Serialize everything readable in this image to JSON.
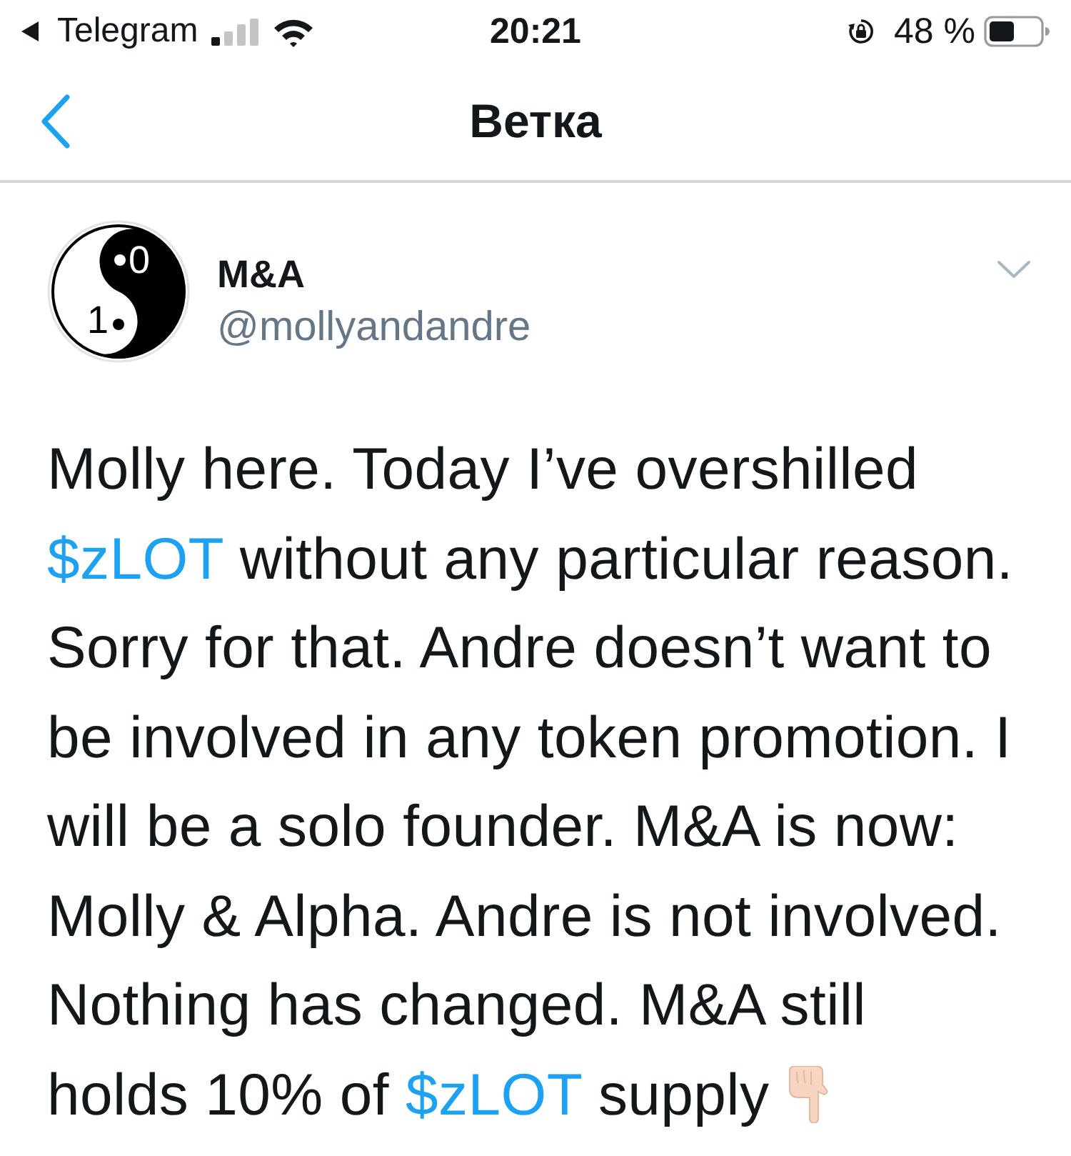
{
  "status_bar": {
    "back_app": "Telegram",
    "time": "20:21",
    "battery": "48 %"
  },
  "nav": {
    "title": "Ветка"
  },
  "tweet": {
    "author": {
      "name": "M&A",
      "handle": "@mollyandandre",
      "avatar_digits": [
        "0",
        "1"
      ]
    },
    "body": [
      {
        "kind": "text",
        "text": "Molly here. Today I’ve overshilled\n"
      },
      {
        "kind": "cashtag",
        "text": "$zLOT"
      },
      {
        "kind": "text",
        "text": " without any particular reason.\nSorry for that. Andre doesn’t want to\nbe involved in any token promotion. I\nwill be a solo founder. M&A is now:\nMolly & Alpha. Andre is not involved.\nNothing has changed. M&A still\nholds 10% of "
      },
      {
        "kind": "cashtag",
        "text": "$zLOT"
      },
      {
        "kind": "text",
        "text": " supply "
      }
    ]
  }
}
